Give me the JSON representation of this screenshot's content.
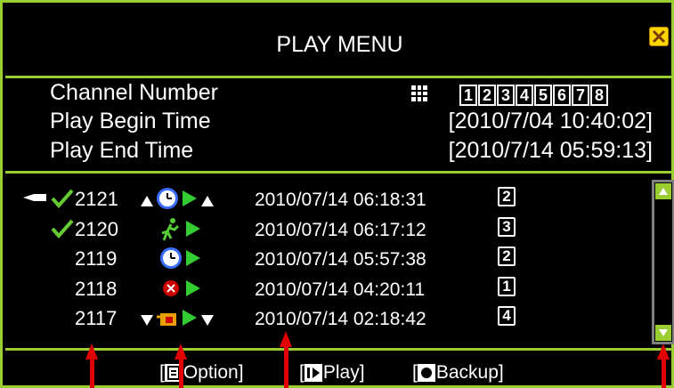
{
  "dialog": {
    "title": "PLAY MENU",
    "close_icon": "close-icon",
    "accent_color": "#9acd32"
  },
  "info": {
    "channel_label": "Channel Number",
    "begin_label": "Play Begin Time",
    "begin_value": "[2010/7/04 10:40:02]",
    "end_label": "Play End Time",
    "end_value": "[2010/7/14 05:59:13]",
    "channels": [
      "1",
      "2",
      "3",
      "4",
      "5",
      "6",
      "7",
      "8"
    ]
  },
  "records": [
    {
      "num": "2121",
      "icons": [
        "▲",
        "clock-icon",
        "play-icon",
        "▲"
      ],
      "time": "2010/07/14 06:18:31",
      "channel": "2",
      "selected": true,
      "checked": true
    },
    {
      "num": "2120",
      "icons": [
        "motion-icon",
        "play-icon"
      ],
      "time": "2010/07/14 06:17:12",
      "channel": "3",
      "selected": false,
      "checked": true
    },
    {
      "num": "2119",
      "icons": [
        "clock-icon",
        "play-icon"
      ],
      "time": "2010/07/14 05:57:38",
      "channel": "2",
      "selected": false,
      "checked": false
    },
    {
      "num": "2118",
      "icons": [
        "alarm-icon",
        "play-icon"
      ],
      "time": "2010/07/14 04:20:11",
      "channel": "1",
      "selected": false,
      "checked": false
    },
    {
      "num": "2117",
      "icons": [
        "▼",
        "sensor-icon",
        "play-icon",
        "▼"
      ],
      "time": "2010/07/14 02:18:42",
      "channel": "4",
      "selected": false,
      "checked": false
    }
  ],
  "footer": {
    "option_open": "[",
    "option_label": "Option]",
    "play_open": "[",
    "play_label": "Play]",
    "backup_open": "[",
    "backup_label": "Backup]"
  }
}
